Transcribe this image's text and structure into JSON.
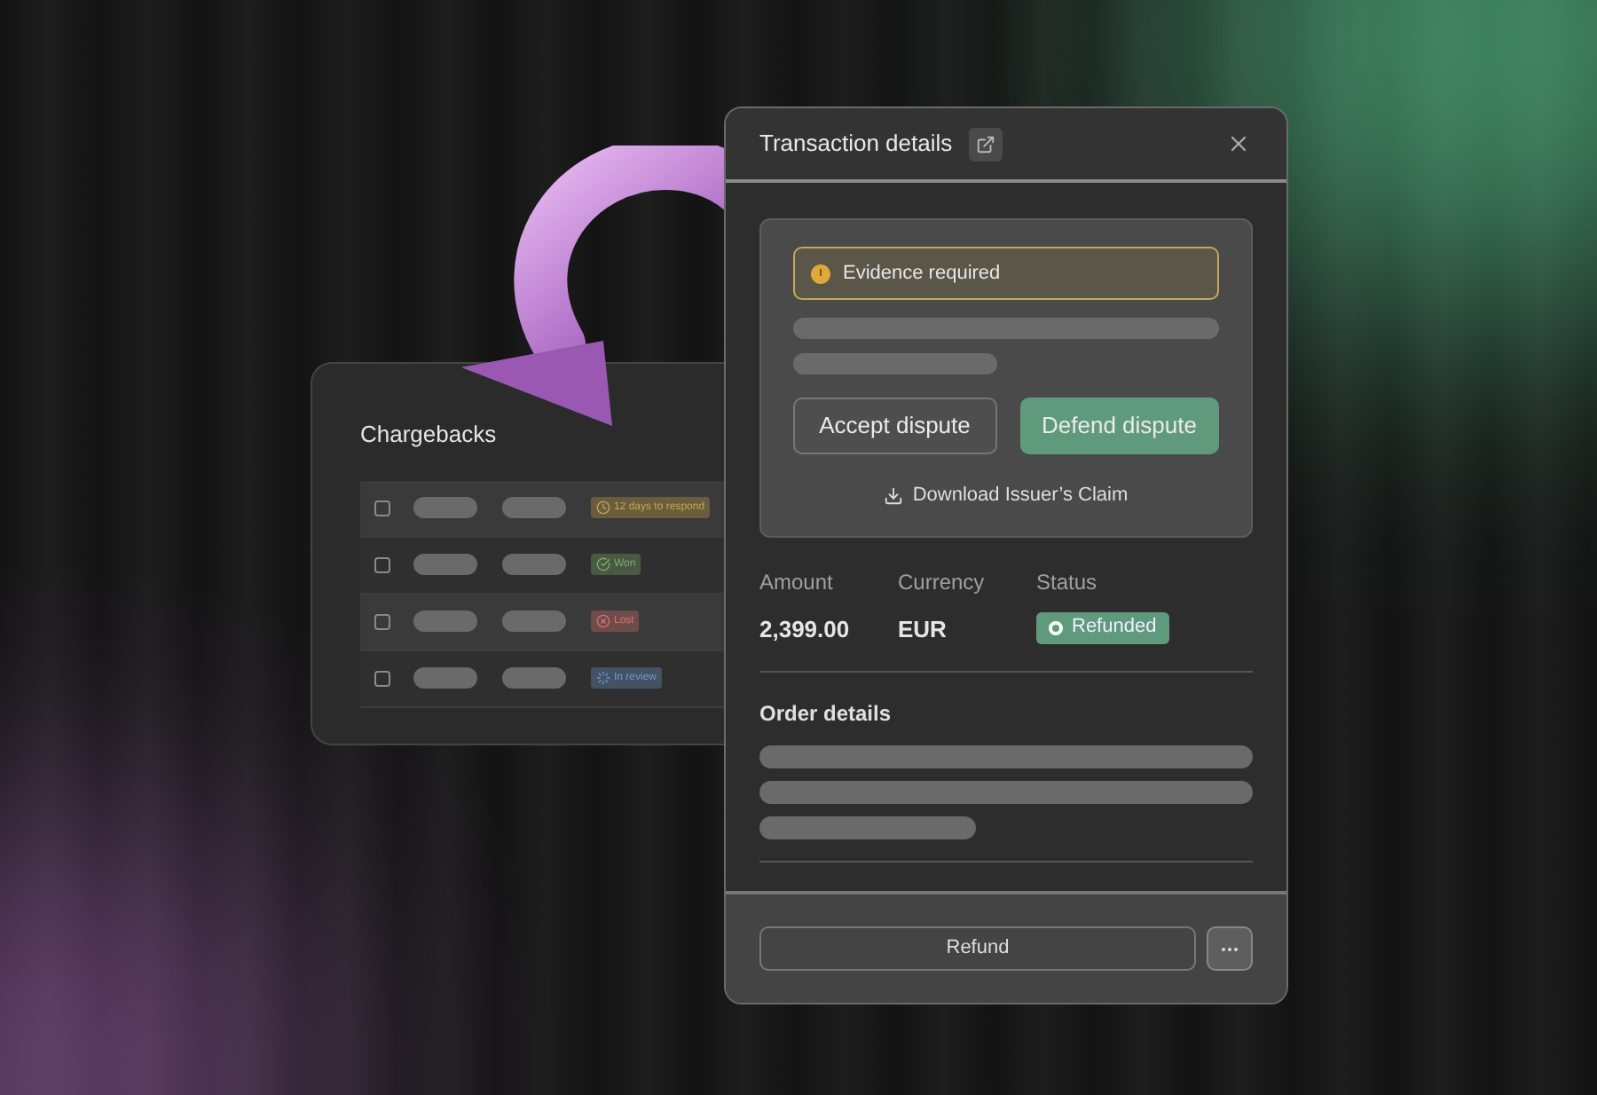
{
  "chargebacks": {
    "title": "Chargebacks",
    "rows": [
      {
        "checked": false,
        "status": {
          "kind": "clock",
          "label": "12 days to respond",
          "color": "#c9a64a"
        }
      },
      {
        "checked": false,
        "status": {
          "kind": "check",
          "label": "Won",
          "color": "#7fae6e"
        }
      },
      {
        "checked": false,
        "status": {
          "kind": "cross",
          "label": "Lost",
          "color": "#d9726f"
        }
      },
      {
        "checked": false,
        "status": {
          "kind": "progress",
          "label": "In review",
          "color": "#6f9ad0"
        }
      }
    ]
  },
  "transaction": {
    "title": "Transaction details",
    "alert": {
      "text": "Evidence required"
    },
    "actions": [
      {
        "label": "Accept dispute",
        "kind": "secondary"
      },
      {
        "label": "Defend dispute",
        "kind": "primary"
      }
    ],
    "download": "Download Issuer’s Claim",
    "fields": [
      {
        "label": "Amount",
        "value": "2,399.00"
      },
      {
        "label": "Currency",
        "value": "EUR"
      },
      {
        "label": "Status",
        "badge": "Refunded"
      }
    ],
    "order_details": {
      "title": "Order details"
    },
    "footer": {
      "button": "Refund"
    }
  }
}
